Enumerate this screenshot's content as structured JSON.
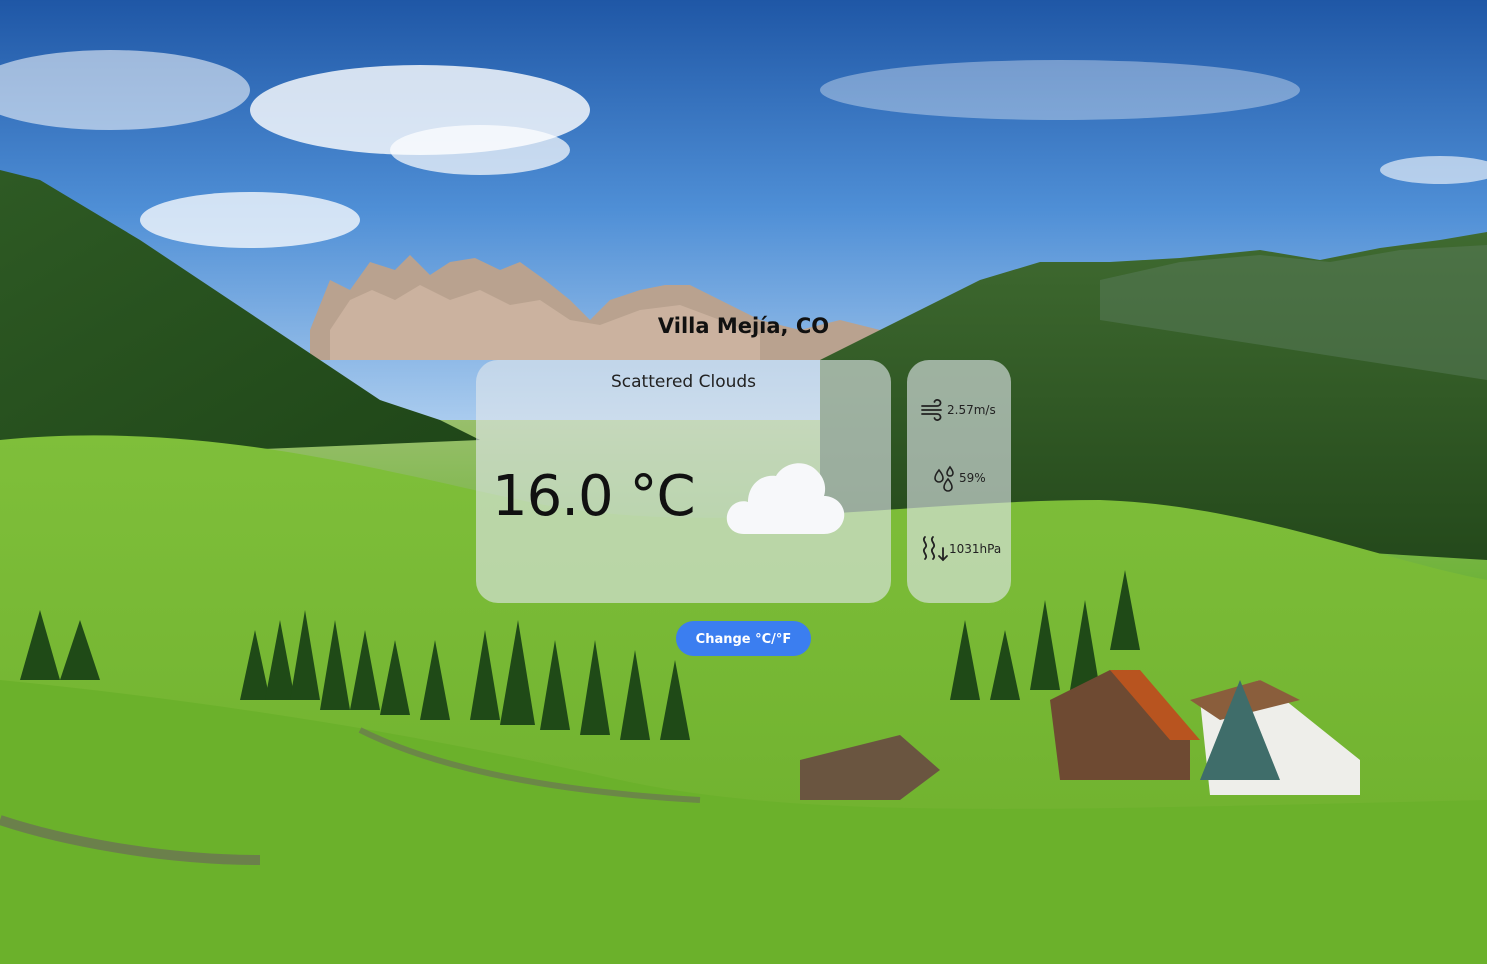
{
  "weather": {
    "city": "Villa Mejía, CO",
    "description": "Scattered Clouds",
    "temperature": "16.0 °C",
    "condition_icon": "cloud-icon"
  },
  "details": {
    "wind": {
      "icon": "wind-icon",
      "value": "2.57m/s"
    },
    "humidity": {
      "icon": "humidity-icon",
      "value": "59%"
    },
    "pressure": {
      "icon": "pressure-icon",
      "value": "1031hPa"
    }
  },
  "controls": {
    "toggle_units_label": "Change °C/°F"
  },
  "colors": {
    "button": "#3b7ef0",
    "card": "rgba(225,230,235,0.62)"
  }
}
